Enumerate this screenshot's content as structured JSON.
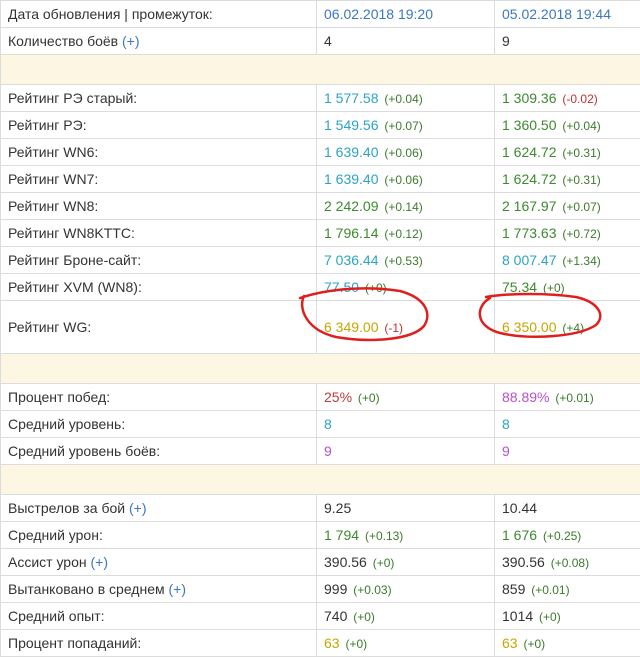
{
  "header": {
    "label": "Дата обновления | промежуток:",
    "date_a": "06.02.2018 19:20",
    "date_b": "05.02.2018 19:44"
  },
  "battles_row": {
    "label": "Количество боёв",
    "plus": "(+)",
    "a": "4",
    "b": "9"
  },
  "ratings": [
    {
      "label": "Рейтинг РЭ старый:",
      "a": "1 577.58",
      "a_delta": "(+0.04)",
      "b": "1 309.36",
      "b_delta": "(-0.02)"
    },
    {
      "label": "Рейтинг РЭ:",
      "a": "1 549.56",
      "a_delta": "(+0.07)",
      "b": "1 360.50",
      "b_delta": "(+0.04)"
    },
    {
      "label": "Рейтинг WN6:",
      "a": "1 639.40",
      "a_delta": "(+0.06)",
      "b": "1 624.72",
      "b_delta": "(+0.31)"
    },
    {
      "label": "Рейтинг WN7:",
      "a": "1 639.40",
      "a_delta": "(+0.06)",
      "b": "1 624.72",
      "b_delta": "(+0.31)"
    },
    {
      "label": "Рейтинг WN8:",
      "a": "2 242.09",
      "a_delta": "(+0.14)",
      "b": "2 167.97",
      "b_delta": "(+0.07)"
    },
    {
      "label": "Рейтинг WN8KTTC:",
      "a": "1 796.14",
      "a_delta": "(+0.12)",
      "b": "1 773.63",
      "b_delta": "(+0.72)"
    },
    {
      "label": "Рейтинг Броне-сайт:",
      "a": "7 036.44",
      "a_delta": "(+0.53)",
      "b": "8 007.47",
      "b_delta": "(+1.34)"
    },
    {
      "label": "Рейтинг XVM (WN8):",
      "a": "77.50",
      "a_delta": "(+0)",
      "b": "75.34",
      "b_delta": "(+0)"
    },
    {
      "label": "Рейтинг WG:",
      "a": "6 349.00",
      "a_delta": "(-1)",
      "b": "6 350.00",
      "b_delta": "(+4)"
    }
  ],
  "general": [
    {
      "label": "Процент побед:",
      "a": "25%",
      "a_delta": "(+0)",
      "b": "88.89%",
      "b_delta": "(+0.01)"
    },
    {
      "label": "Средний уровень:",
      "a": "8",
      "b": "8"
    },
    {
      "label": "Средний уровень боёв:",
      "a": "9",
      "b": "9"
    }
  ],
  "combat": [
    {
      "label": "Выстрелов за бой",
      "plus": "(+)",
      "a": "9.25",
      "b": "10.44"
    },
    {
      "label": "Средний урон:",
      "a": "1 794",
      "a_delta": "(+0.13)",
      "b": "1 676",
      "b_delta": "(+0.25)"
    },
    {
      "label": "Ассист урон",
      "plus": "(+)",
      "a": "390.56",
      "a_delta": "(+0)",
      "b": "390.56",
      "b_delta": "(+0.08)"
    },
    {
      "label": "Вытанковано в среднем",
      "plus": "(+)",
      "a": "999",
      "a_delta": "(+0.03)",
      "b": "859",
      "b_delta": "(+0.01)"
    },
    {
      "label": "Средний опыт:",
      "a": "740",
      "a_delta": "(+0)",
      "b": "1014",
      "b_delta": "(+0)"
    },
    {
      "label": "Процент попаданий:",
      "a": "63",
      "a_delta": "(+0)",
      "b": "63",
      "b_delta": "(+0)"
    }
  ]
}
